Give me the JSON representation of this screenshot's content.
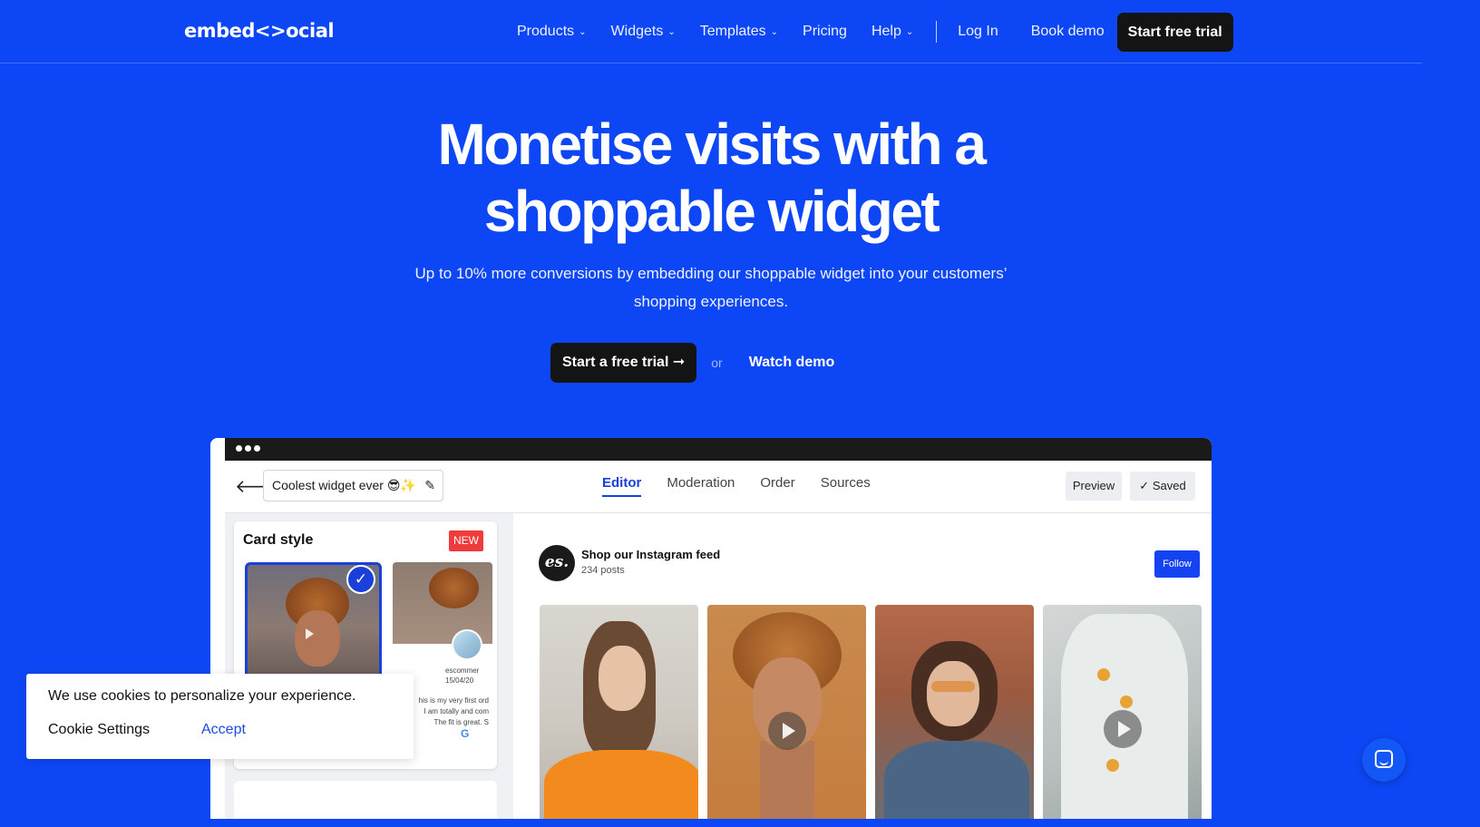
{
  "nav": {
    "logo": "embed<>ocial",
    "items": [
      {
        "label": "Products",
        "dropdown": true
      },
      {
        "label": "Widgets",
        "dropdown": true
      },
      {
        "label": "Templates",
        "dropdown": true
      },
      {
        "label": "Pricing",
        "dropdown": false
      },
      {
        "label": "Help",
        "dropdown": true
      }
    ],
    "login": "Log In",
    "book_demo": "Book demo",
    "cta": "Start free trial"
  },
  "hero": {
    "title_line1": "Monetise visits with a",
    "title_line2": "shoppable widget",
    "subtitle": "Up to 10% more conversions by embedding our shoppable widget into your customers’ shopping experiences.",
    "cta_primary": "Start a free trial ➞",
    "or": "or",
    "cta_secondary": "Watch demo"
  },
  "mockup": {
    "widget_name": "Coolest widget ever 😎✨",
    "tabs": [
      {
        "label": "Editor",
        "active": true
      },
      {
        "label": "Moderation",
        "active": false
      },
      {
        "label": "Order",
        "active": false
      },
      {
        "label": "Sources",
        "active": false
      }
    ],
    "preview_label": "Preview",
    "saved_label": "Saved",
    "card_style_title": "Card style",
    "new_badge": "NEW",
    "review_meta": "escommer\n15/04/20",
    "review_text": "his is my very first ord\nI am totally and com\nThe fit is great. S",
    "feed_avatar": "es.",
    "feed_title": "Shop our Instagram feed",
    "feed_posts": "234 posts",
    "follow_label": "Follow"
  },
  "cookie": {
    "message": "We use cookies to personalize your experience.",
    "settings": "Cookie Settings",
    "accept": "Accept"
  },
  "colors": {
    "background": "#0d47f5",
    "dark_button": "#141414",
    "accent": "#1b3fd9",
    "new_badge": "#ef3b3b"
  },
  "icons": [
    "chevron-down-icon",
    "arrow-left-icon",
    "pencil-icon",
    "check-icon",
    "play-icon",
    "chat-icon"
  ]
}
